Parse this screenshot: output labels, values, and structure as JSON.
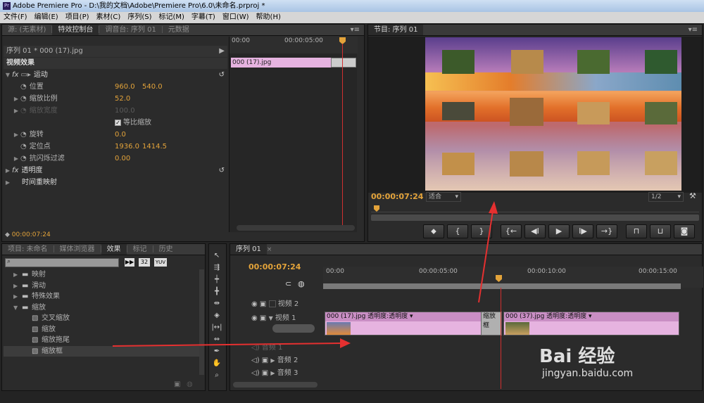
{
  "titlebar": {
    "title": "Adobe Premiere Pro - D:\\我的文档\\Adobe\\Premiere Pro\\6.0\\未命名.prproj *"
  },
  "menu": [
    "文件(F)",
    "编辑(E)",
    "项目(P)",
    "素材(C)",
    "序列(S)",
    "标记(M)",
    "字幕(T)",
    "窗口(W)",
    "帮助(H)"
  ],
  "effect_controls": {
    "tabs": [
      "源: (无素材)",
      "特效控制台",
      "调音台: 序列 01",
      "元数据"
    ],
    "clip_path": "序列 01 * 000 (17).jpg",
    "video_effects": "视频效果",
    "motion": "运动",
    "position_label": "位置",
    "position_x": "960.0",
    "position_y": "540.0",
    "scale_label": "缩放比例",
    "scale_value": "52.0",
    "scale_width_label": "缩放宽度",
    "scale_width_value": "100.0",
    "uniform_scale": "等比缩放",
    "rotation_label": "旋转",
    "rotation_value": "0.0",
    "anchor_label": "定位点",
    "anchor_x": "1936.0",
    "anchor_y": "1414.5",
    "antiflicker_label": "抗闪烁过滤",
    "antiflicker_value": "0.00",
    "opacity": "透明度",
    "time_remap": "时间重映射",
    "ruler_start": "00:00",
    "ruler_mid": "00:00:05:00",
    "mini_clip": "000 (17).jpg",
    "timecode": "00:00:07:24"
  },
  "program": {
    "tab": "节目: 序列 01",
    "timecode": "00:00:07:24",
    "fit": "适合",
    "quality": "1/2"
  },
  "project": {
    "tabs": [
      "项目: 未命名",
      "媒体浏览器",
      "效果",
      "标记",
      "历史"
    ],
    "badges": [
      "32",
      "YUV"
    ],
    "items": [
      {
        "label": "映射",
        "type": "folder",
        "indent": 1
      },
      {
        "label": "滑动",
        "type": "folder",
        "indent": 1
      },
      {
        "label": "特殊效果",
        "type": "folder",
        "indent": 1
      },
      {
        "label": "缩放",
        "type": "folder",
        "indent": 1,
        "open": true
      },
      {
        "label": "交叉缩放",
        "type": "effect",
        "indent": 2
      },
      {
        "label": "缩放",
        "type": "effect",
        "indent": 2
      },
      {
        "label": "缩放拖尾",
        "type": "effect",
        "indent": 2
      },
      {
        "label": "缩放框",
        "type": "effect",
        "indent": 2,
        "selected": true
      }
    ]
  },
  "timeline": {
    "tab": "序列 01",
    "timecode": "00:00:07:24",
    "ruler": [
      "00:00",
      "00:00:05:00",
      "00:00:10:00",
      "00:00:15:00"
    ],
    "tracks": [
      "视频 2",
      "视频 1",
      "音频 1",
      "音频 2",
      "音频 3"
    ],
    "clip1": "000 (17).jpg 透明度:透明度 ▾",
    "transition": "缩放框",
    "clip2": "000 (37).jpg 透明度:透明度 ▾"
  },
  "watermark": {
    "brand": "Bai 经验",
    "url": "jingyan.baidu.com"
  },
  "colors": {
    "accent": "#e3a33a",
    "clip": "#e6b3e0",
    "playhead": "#d03030",
    "arrow": "#e53030"
  }
}
